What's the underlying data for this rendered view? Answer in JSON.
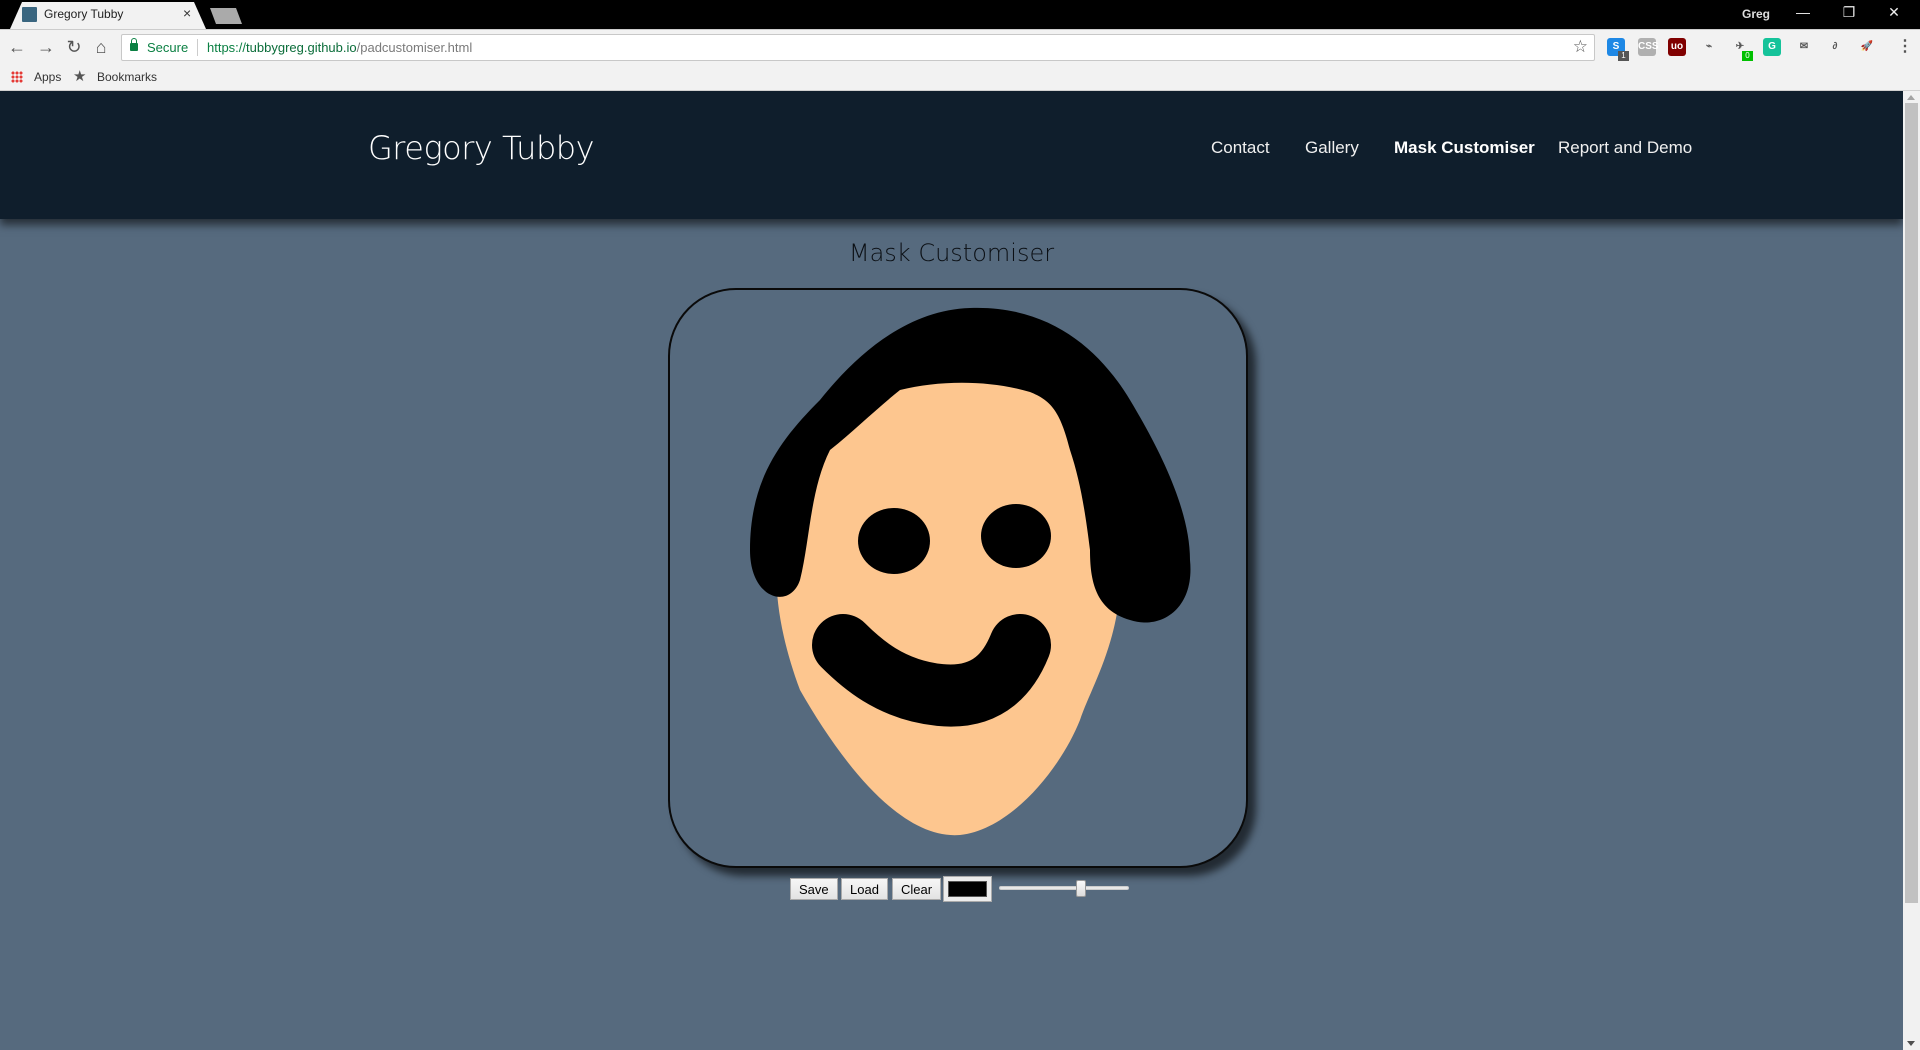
{
  "browser": {
    "tab_title": "Gregory Tubby",
    "tab_close": "×",
    "profile_name": "Greg",
    "window_controls": {
      "minimize": "—",
      "restore": "❐",
      "close": "✕"
    },
    "nav": {
      "back": "←",
      "forward": "→",
      "reload": "↻",
      "home": "⌂"
    },
    "secure_label": "Secure",
    "url": {
      "scheme": "https://",
      "host": "tubbygreg.github.io",
      "path": "/padcustomiser.html"
    },
    "star": "☆",
    "extensions": [
      {
        "name": "skype-extension",
        "label": "S",
        "color": "#1e88e5",
        "badge": "1",
        "badge_color": "#555555"
      },
      {
        "name": "css-viewer-extension",
        "label": "CSS",
        "color": "#b0b0b0"
      },
      {
        "name": "ublock-extension",
        "label": "uo",
        "color": "#800000"
      },
      {
        "name": "cast-extension",
        "label": "⌁",
        "color": "#f2f2f2"
      },
      {
        "name": "bird-extension",
        "label": "✈",
        "color": "#f2f2f2",
        "badge": "0",
        "badge_color": "#00c000"
      },
      {
        "name": "grammarly-extension",
        "label": "G",
        "color": "#15c39a"
      },
      {
        "name": "mail-extension",
        "label": "✉",
        "color": "#f2f2f2"
      },
      {
        "name": "grey-extension",
        "label": "∂",
        "color": "#f2f2f2"
      },
      {
        "name": "rocket-extension",
        "label": "🚀",
        "color": "#f2f2f2"
      }
    ],
    "menu": "⋮",
    "bookmarks": {
      "apps_label": "Apps",
      "bookmarks_label": "Bookmarks"
    }
  },
  "site": {
    "title": "Gregory Tubby",
    "nav": [
      {
        "label": "Contact",
        "active": false
      },
      {
        "label": "Gallery",
        "active": false
      },
      {
        "label": "Mask Customiser",
        "active": true
      },
      {
        "label": "Report and Demo",
        "active": false
      }
    ]
  },
  "main": {
    "heading": "Mask Customiser",
    "canvas": {
      "background": "#566a7e",
      "skin_color": "#fdc68f",
      "ink_color": "#000000",
      "drawing": "face-with-hair-eyes-and-smile"
    },
    "controls": {
      "save_label": "Save",
      "load_label": "Load",
      "clear_label": "Clear",
      "brush_color": "#000000",
      "brush_size_fraction": 0.63
    }
  },
  "colors": {
    "header_bg": "#0f1e2c",
    "page_bg": "#566a7e"
  }
}
